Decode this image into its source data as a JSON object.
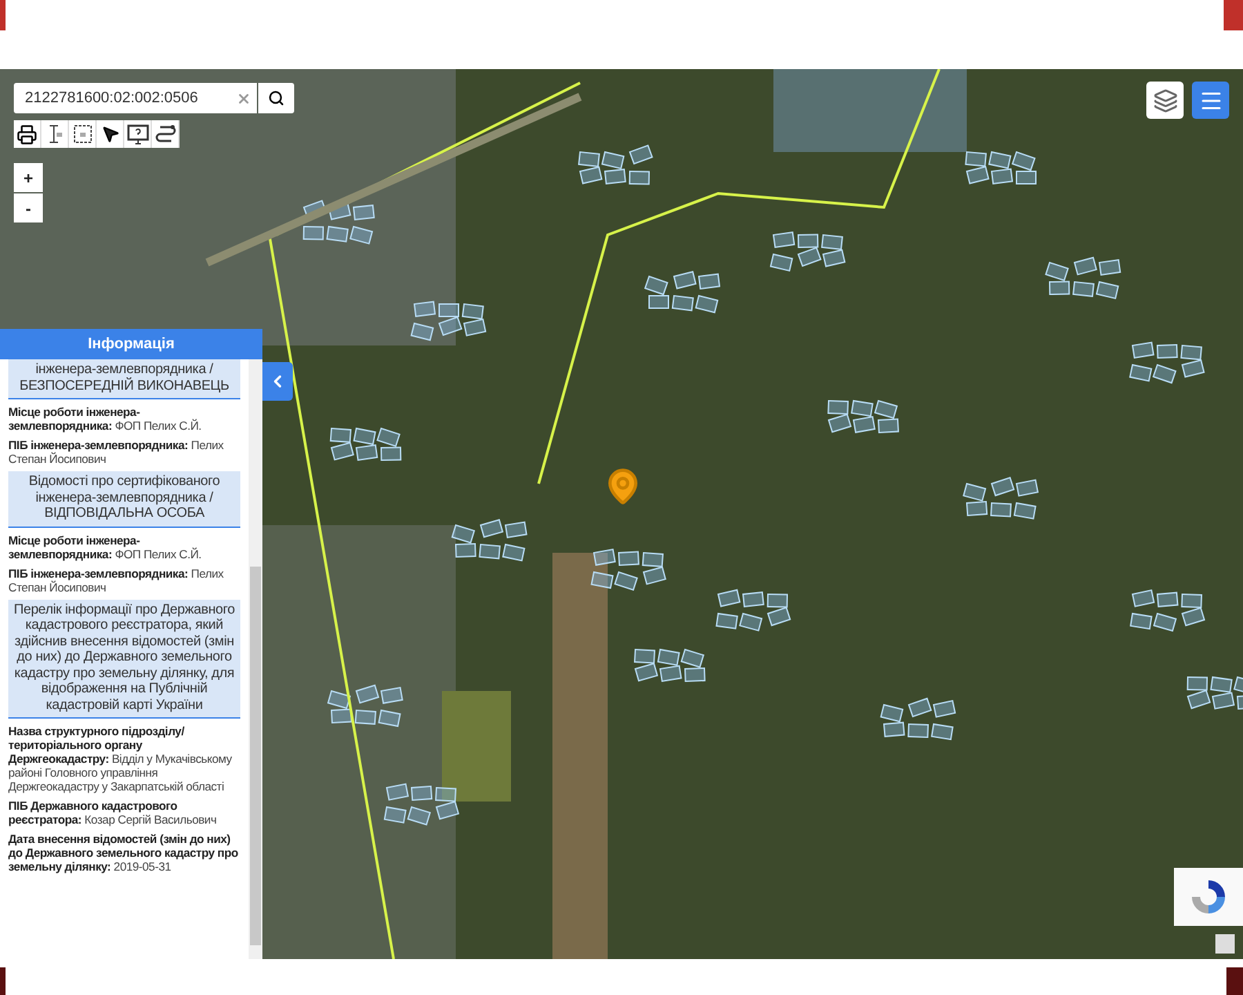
{
  "search": {
    "value": "2122781600:02:002:0506"
  },
  "zoom": {
    "in": "+",
    "out": "-"
  },
  "panel": {
    "title": "Інформація",
    "expanded": true,
    "items": [
      {
        "kind": "heading",
        "text": "інженера-землевпорядника / БЕЗПОСЕРЕДНІЙ ВИКОНАВЕЦЬ"
      },
      {
        "kind": "field",
        "text": "**Місце роботи інженера-землевпорядника:** ФОП Пелих С.Й."
      },
      {
        "kind": "field",
        "text": "**ПІБ інженера-землевпорядника:** Пелих Степан Йосипович"
      },
      {
        "kind": "heading",
        "text": "Відомості про сертифікованого інженера-землевпорядника / ВІДПОВІДАЛЬНА ОСОБА"
      },
      {
        "kind": "field",
        "text": "**Місце роботи інженера-землевпорядника:** ФОП Пелих С.Й."
      },
      {
        "kind": "field",
        "text": "**ПІБ інженера-землевпорядника:** Пелих Степан Йосипович"
      },
      {
        "kind": "heading",
        "text": "Перелік інформації про Державного кадастрового реєстратора, який здійснив внесення відомостей (змін до них) до Державного земельного кадастру про земельну ділянку, для відображення на Публічній кадастровій карті України"
      },
      {
        "kind": "field",
        "text": "**Назва структурного підрозділу/ територіального органу Держгеокадастру:** Відділ у Мукачівському районі Головного управління Держгеокадастру у Закарпатській області"
      },
      {
        "kind": "field",
        "text": "**ПІБ Державного кадастрового реєстратора:** Козар Сергій Васильович"
      },
      {
        "kind": "field",
        "text": "**Дата внесення відомостей (змін до них) до Державного земельного кадастру про земельну ділянку:** 2019-05-31"
      }
    ]
  }
}
